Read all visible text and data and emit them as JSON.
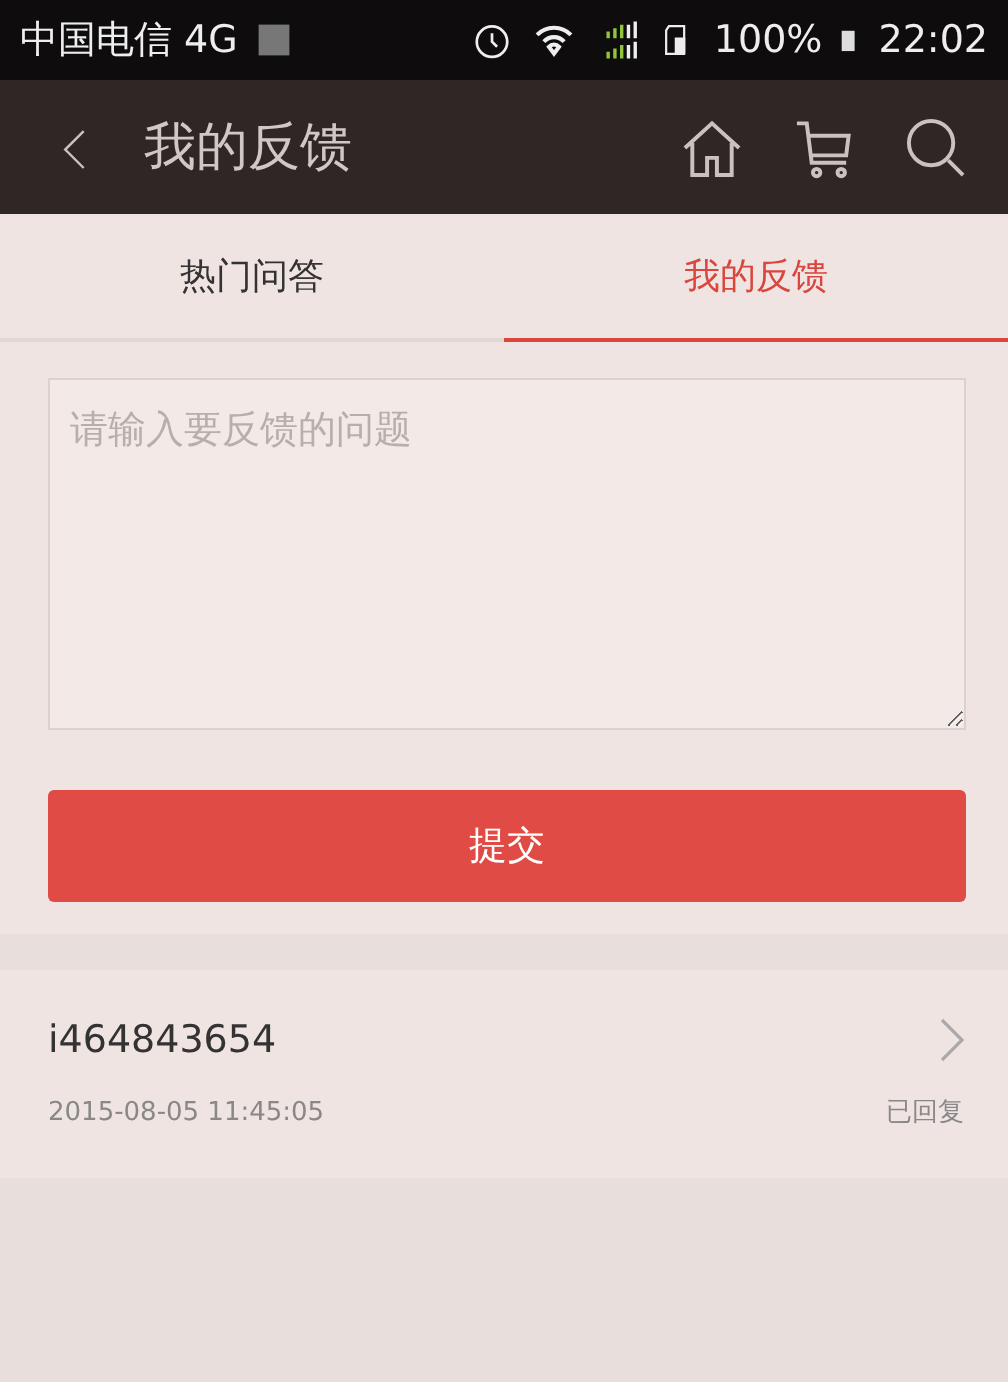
{
  "status_bar": {
    "carrier": "中国电信 4G",
    "battery": "100%",
    "time": "22:02"
  },
  "nav": {
    "title": "我的反馈"
  },
  "tabs": [
    {
      "label": "热门问答",
      "selected": false
    },
    {
      "label": "我的反馈",
      "selected": true
    }
  ],
  "feedback": {
    "placeholder": "请输入要反馈的问题",
    "submit": "提交"
  },
  "items": [
    {
      "title": "i464843654",
      "date": "2015-08-05 11:45:05",
      "status": "已回复"
    }
  ]
}
